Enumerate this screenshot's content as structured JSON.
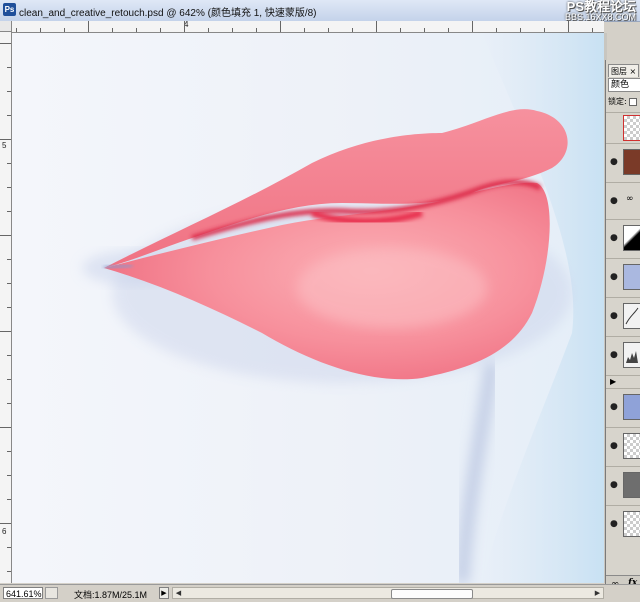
{
  "window": {
    "icon_label": "Ps",
    "title": "clean_and_creative_retouch.psd @ 642% (颜色填充 1, 快速蒙版/8)"
  },
  "watermark": {
    "line1": "PS教程论坛",
    "line2": "BBS.16XX8.COM"
  },
  "rulers": {
    "top_labels": [
      "4"
    ],
    "left_labels": [
      "5",
      "6"
    ]
  },
  "status": {
    "zoom": "641.61%",
    "document_info": "文档:1.87M/25.1M",
    "arrow": "▶",
    "scroll_left": "◀",
    "scroll_right": "▶"
  },
  "layers_panel": {
    "tab_label": "图层 ×",
    "blend_mode": "颜色",
    "lock_label": "锁定:",
    "layers": [
      {
        "name": "empty-selected-layer",
        "visible": false,
        "thumb": "checker-red-border"
      },
      {
        "name": "color-fill-layer",
        "visible": true,
        "thumb": "brown"
      },
      {
        "name": "adjustment-link",
        "visible": true,
        "thumb": "link"
      },
      {
        "name": "gradient-map-layer",
        "visible": true,
        "thumb": "gradient"
      },
      {
        "name": "photo-blue-layer",
        "visible": true,
        "thumb": "blue-photo"
      },
      {
        "name": "curves-layer",
        "visible": true,
        "thumb": "curves"
      },
      {
        "name": "levels-layer",
        "visible": true,
        "thumb": "levels"
      },
      {
        "name": "photo-layer-2",
        "visible": true,
        "thumb": "blue-photo"
      },
      {
        "name": "transparent-layer-1",
        "visible": true,
        "thumb": "checker"
      },
      {
        "name": "gray-layer",
        "visible": true,
        "thumb": "gray"
      },
      {
        "name": "transparent-layer-2",
        "visible": true,
        "thumb": "checker"
      }
    ],
    "group_arrow": "▶",
    "fx_label": "fx",
    "link_symbol": "∞",
    "eye_symbol": "●"
  },
  "colors": {
    "lip_base": "#f47e8c",
    "lip_highlight": "#f9a5ad",
    "lip_shadow": "#e23350",
    "skin": "#eef1f7",
    "skin_shadow": "#b9c4e0",
    "background_blue": "#c8e1f3"
  }
}
